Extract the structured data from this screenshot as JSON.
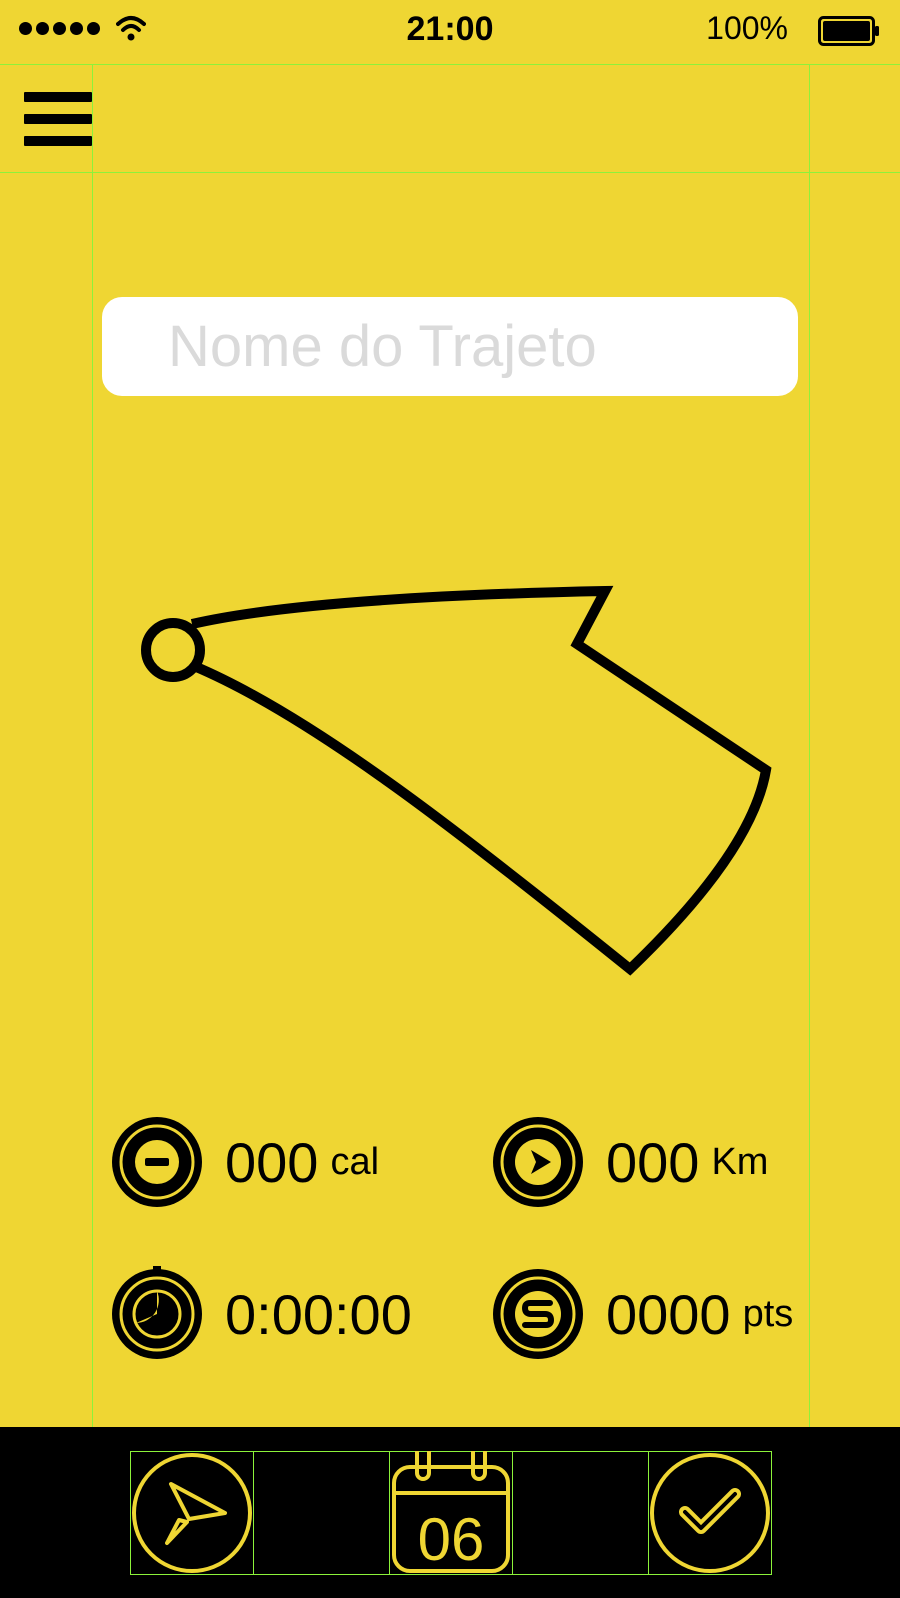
{
  "status_bar": {
    "time": "21:00",
    "battery_percent": "100%",
    "signal_bars": 5
  },
  "route_name": {
    "placeholder": "Nome do Trajeto",
    "value": ""
  },
  "stats": {
    "calories": {
      "value": "000",
      "unit": "cal",
      "icon": "calories-icon"
    },
    "distance": {
      "value": "000",
      "unit": "Km",
      "icon": "distance-icon"
    },
    "duration": {
      "value": "0:00:00",
      "icon": "stopwatch-icon"
    },
    "points": {
      "value": "0000",
      "unit": "pts",
      "icon": "points-icon"
    }
  },
  "bottom_nav": {
    "navigate_icon": "paper-plane-icon",
    "calendar_day": "06",
    "confirm_icon": "checkmark-icon"
  },
  "colors": {
    "background": "#EFD633",
    "accent": "#EFD633",
    "bar": "#000000",
    "guides": "#8CF23A"
  }
}
